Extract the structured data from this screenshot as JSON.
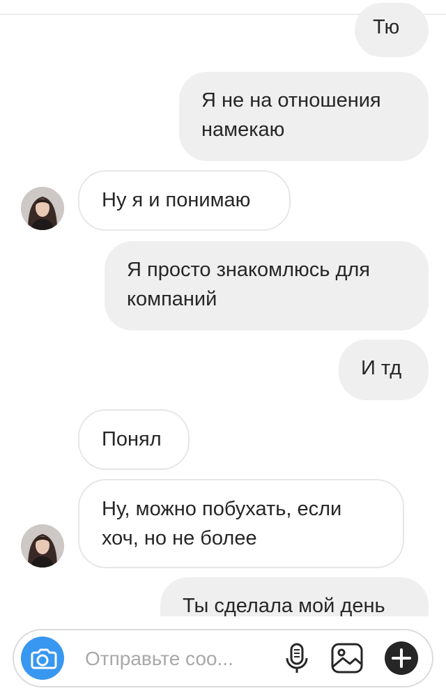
{
  "messages": [
    {
      "side": "out",
      "text": "Тю"
    },
    {
      "side": "out",
      "text": "Я не на отношения намекаю"
    },
    {
      "side": "in",
      "text": "Ну я и понимаю"
    },
    {
      "side": "out",
      "text": "Я просто знакомлюсь для компаний"
    },
    {
      "side": "out",
      "text": "И тд"
    },
    {
      "side": "in",
      "text": "Понял"
    },
    {
      "side": "in",
      "text": "Ну, можно побухать, если хоч, но не более"
    },
    {
      "side": "out",
      "text": "Ты сделала мой день"
    }
  ],
  "composer": {
    "placeholder": "Отправьте соо..."
  },
  "icons": {
    "camera": "camera-icon",
    "microphone": "microphone-icon",
    "gallery": "image-icon",
    "add": "plus-icon"
  },
  "colors": {
    "accent": "#3897f0",
    "outgoing_bubble": "#efefef",
    "incoming_border": "#e6e6e6",
    "placeholder": "#a8a8a8"
  }
}
